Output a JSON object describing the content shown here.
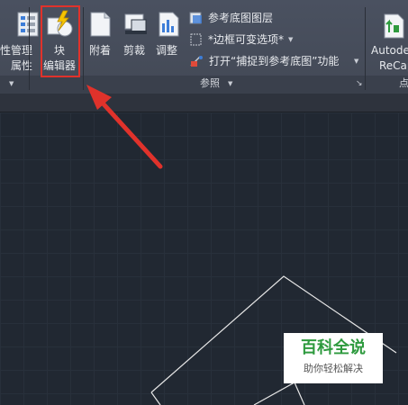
{
  "ribbon": {
    "left_group": {
      "label_line1": "管理",
      "label_line2": "属性",
      "edge_label": "性"
    },
    "block_editor": {
      "label_line1": "块",
      "label_line2": "编辑器"
    },
    "reference": {
      "attach": "附着",
      "clip": "剪裁",
      "adjust": "调整",
      "underlay_layers": "参考底图图层",
      "frame_variable": "*边框可变选项*",
      "snap_underlay": "打开“捕捉到参考底图”功能",
      "panel_title": "参照"
    },
    "autodesk": {
      "line1": "Autode",
      "line2": "ReCap"
    },
    "right_edge_char": "点"
  },
  "watermark": {
    "title": "百科全说",
    "subtitle": "助你轻松解决"
  },
  "colors": {
    "highlight": "#e0322b",
    "arrow": "#e0322b",
    "drawing_lines": "#e6e6e6"
  }
}
